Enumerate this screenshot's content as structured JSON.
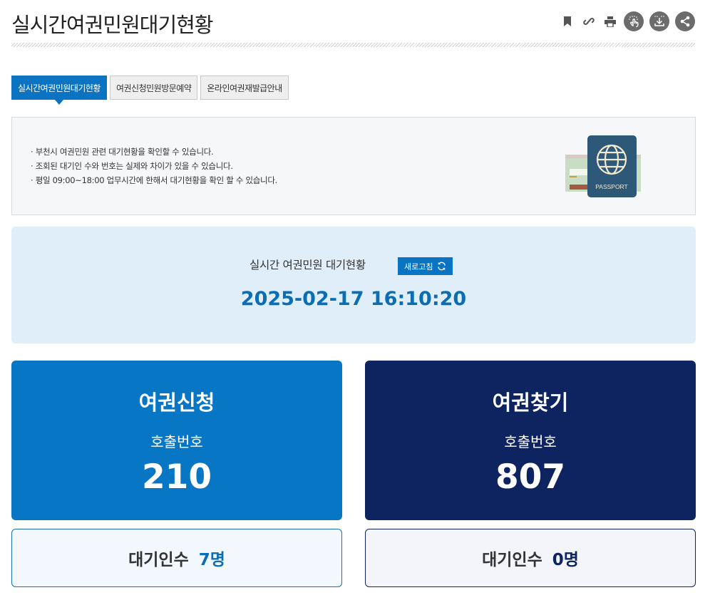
{
  "page_title": "실시간여권민원대기현황",
  "toolbar": {
    "icons": [
      "bookmark-icon",
      "link-icon",
      "print-icon",
      "touch-icon",
      "download-icon",
      "share-icon"
    ]
  },
  "tabs": [
    {
      "label": "실시간여권민원대기현황",
      "active": true
    },
    {
      "label": "여권신청민원방문예약",
      "active": false
    },
    {
      "label": "온라인여권재발급안내",
      "active": false
    }
  ],
  "notice": {
    "lines": [
      "· 부천시 여권민원 관련 대기현황을 확인할 수 있습니다.",
      "· 조회된 대기인 수와 번호는 실제와 차이가 있을 수 있습니다.",
      "· 평일 09:00~18:00 업무시간에 한해서 대기현황을 확인 할 수 있습니다."
    ],
    "passport_text": "PASSPORT"
  },
  "status": {
    "label": "실시간 여권민원 대기현황",
    "refresh_label": "새로고침",
    "datetime": "2025-02-17 16:10:20"
  },
  "cards": {
    "apply": {
      "title": "여권신청",
      "sub": "호출번호",
      "number": "210",
      "wait_label": "대기인수",
      "wait_count": "7명"
    },
    "find": {
      "title": "여권찾기",
      "sub": "호출번호",
      "number": "807",
      "wait_label": "대기인수",
      "wait_count": "0명"
    }
  },
  "colors": {
    "accent": "#0b74c2",
    "apply_card": "#0776c4",
    "find_card": "#0e2461",
    "status_bg": "#dfeef9"
  }
}
